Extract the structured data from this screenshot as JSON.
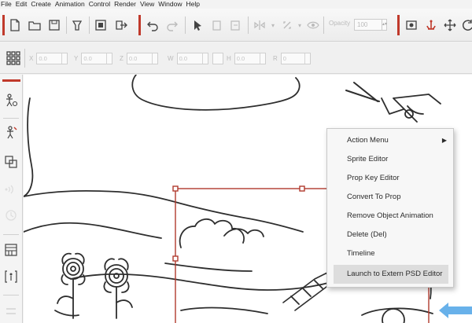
{
  "menubar": {
    "items": [
      "File",
      "Edit",
      "Create",
      "Animation",
      "Control",
      "Render",
      "View",
      "Window",
      "Help"
    ]
  },
  "toolbar": {
    "opacity_label": "Opacity",
    "opacity_value": "100"
  },
  "transform": {
    "fields": [
      {
        "label": "X",
        "value": "0.0"
      },
      {
        "label": "Y",
        "value": "0.0"
      },
      {
        "label": "Z",
        "value": "0.0"
      },
      {
        "label": "W",
        "value": "0.0"
      },
      {
        "label": "H",
        "value": "0.0"
      },
      {
        "label": "R",
        "value": "0"
      }
    ]
  },
  "context_menu": {
    "items": [
      {
        "label": "Action Menu",
        "has_submenu": true
      },
      {
        "label": "Sprite Editor"
      },
      {
        "label": "Prop Key Editor"
      },
      {
        "label": "Convert To Prop"
      },
      {
        "label": "Remove Object Animation"
      },
      {
        "label": "Delete (Del)"
      },
      {
        "label": "Timeline"
      },
      {
        "label": "Launch to Extern PSD Editor",
        "highlighted": true
      }
    ],
    "submenu_arrow": "▶"
  },
  "colors": {
    "accent": "#c0392b",
    "selection": "#b03a2e",
    "arrow_blue": "#4da3e6"
  }
}
